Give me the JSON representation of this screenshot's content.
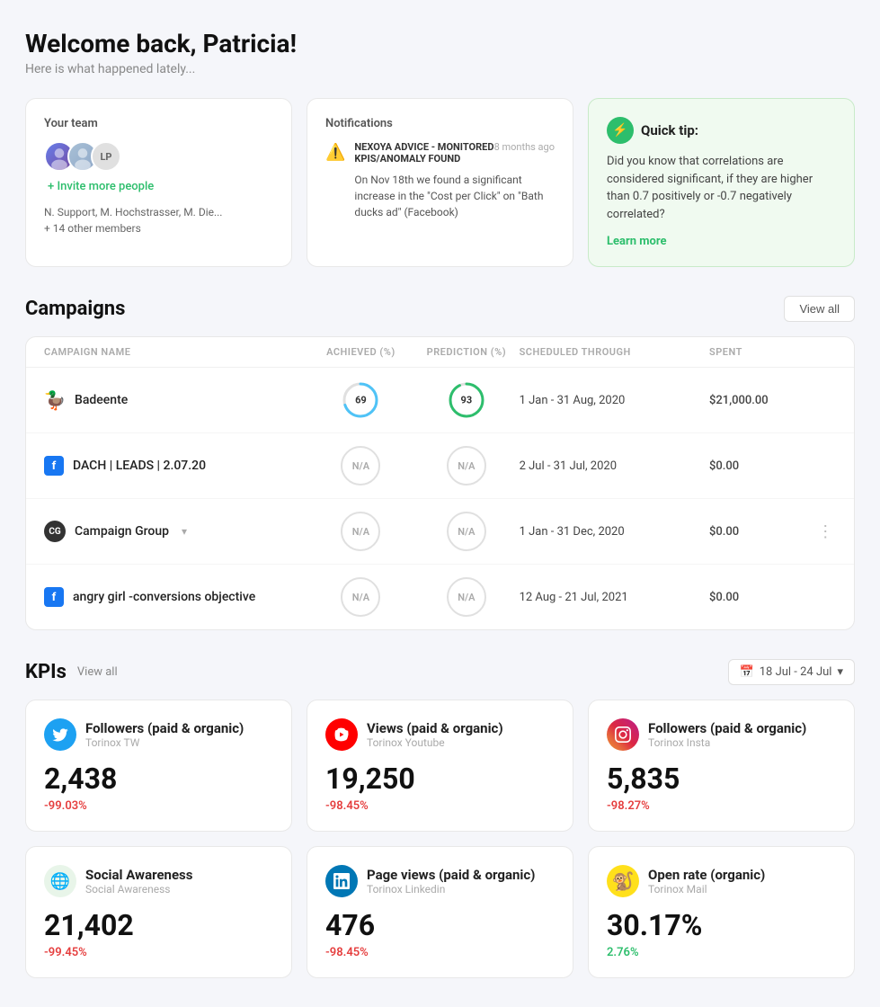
{
  "page": {
    "welcome_title": "Welcome back, Patricia!",
    "welcome_sub": "Here is what happened lately..."
  },
  "team_card": {
    "title": "Your team",
    "invite_label": "+ Invite more people",
    "members_text": "N. Support, M. Hochstrasser, M. Die...",
    "other_members": "+ 14 other members"
  },
  "notifications_card": {
    "title": "Notifications",
    "item": {
      "title": "NEXOYA ADVICE - MONITORED KPIS/ANOMALY FOUND",
      "time": "8 months ago",
      "body": "On Nov 18th we found a significant increase in the \"Cost per Click\" on \"Bath ducks ad\" (Facebook)"
    }
  },
  "quick_tip": {
    "title": "Quick tip:",
    "body": "Did you know that correlations are considered significant, if they are higher than 0.7 positively or -0.7 negatively correlated?",
    "learn_more": "Learn more"
  },
  "campaigns": {
    "section_title": "Campaigns",
    "view_all": "View all",
    "headers": {
      "name": "CAMPAIGN NAME",
      "achieved": "ACHIEVED (%)",
      "prediction": "PREDICTION (%)",
      "scheduled": "SCHEDULED THROUGH",
      "spent": "SPENT"
    },
    "rows": [
      {
        "icon": "🦆",
        "icon_type": "emoji",
        "name": "Badeente",
        "achieved": "69",
        "achieved_type": "circle",
        "achieved_color": "#4fc3f7",
        "prediction": "93",
        "prediction_type": "circle",
        "prediction_color": "#2dbe6c",
        "scheduled": "1 Jan - 31 Aug, 2020",
        "spent": "$21,000.00",
        "has_dots": false
      },
      {
        "icon": "fb",
        "icon_type": "fb",
        "name": "DACH | LEADS | 2.07.20",
        "achieved": "N/A",
        "achieved_type": "na",
        "prediction": "N/A",
        "prediction_type": "na",
        "scheduled": "2 Jul - 31 Jul, 2020",
        "spent": "$0.00",
        "has_dots": false
      },
      {
        "icon": "cg",
        "icon_type": "cg",
        "name": "Campaign Group",
        "achieved": "N/A",
        "achieved_type": "na",
        "prediction": "N/A",
        "prediction_type": "na",
        "scheduled": "1 Jan - 31 Dec, 2020",
        "spent": "$0.00",
        "has_dots": true,
        "has_expand": true
      },
      {
        "icon": "fb",
        "icon_type": "fb",
        "name": "angry girl -conversions objective",
        "achieved": "N/A",
        "achieved_type": "na",
        "prediction": "N/A",
        "prediction_type": "na",
        "scheduled": "12 Aug - 21 Jul, 2021",
        "spent": "$0.00",
        "has_dots": false
      }
    ]
  },
  "kpis": {
    "section_title": "KPIs",
    "view_all": "View all",
    "date_range": "18 Jul - 24 Jul",
    "cards": [
      {
        "platform": "twitter",
        "name": "Followers (paid & organic)",
        "sub": "Torinox TW",
        "value": "2,438",
        "change": "-99.03%",
        "change_type": "negative"
      },
      {
        "platform": "youtube",
        "name": "Views (paid & organic)",
        "sub": "Torinox Youtube",
        "value": "19,250",
        "change": "-98.45%",
        "change_type": "negative"
      },
      {
        "platform": "instagram",
        "name": "Followers (paid & organic)",
        "sub": "Torinox Insta",
        "value": "5,835",
        "change": "-98.27%",
        "change_type": "negative"
      },
      {
        "platform": "social",
        "name": "Social Awareness",
        "sub": "Social Awareness",
        "value": "21,402",
        "change": "-99.45%",
        "change_type": "negative"
      },
      {
        "platform": "linkedin",
        "name": "Page views (paid & organic)",
        "sub": "Torinox Linkedin",
        "value": "476",
        "change": "-98.45%",
        "change_type": "negative"
      },
      {
        "platform": "mailchimp",
        "name": "Open rate (organic)",
        "sub": "Torinox Mail",
        "value": "30.17%",
        "change": "2.76%",
        "change_type": "positive"
      }
    ]
  }
}
